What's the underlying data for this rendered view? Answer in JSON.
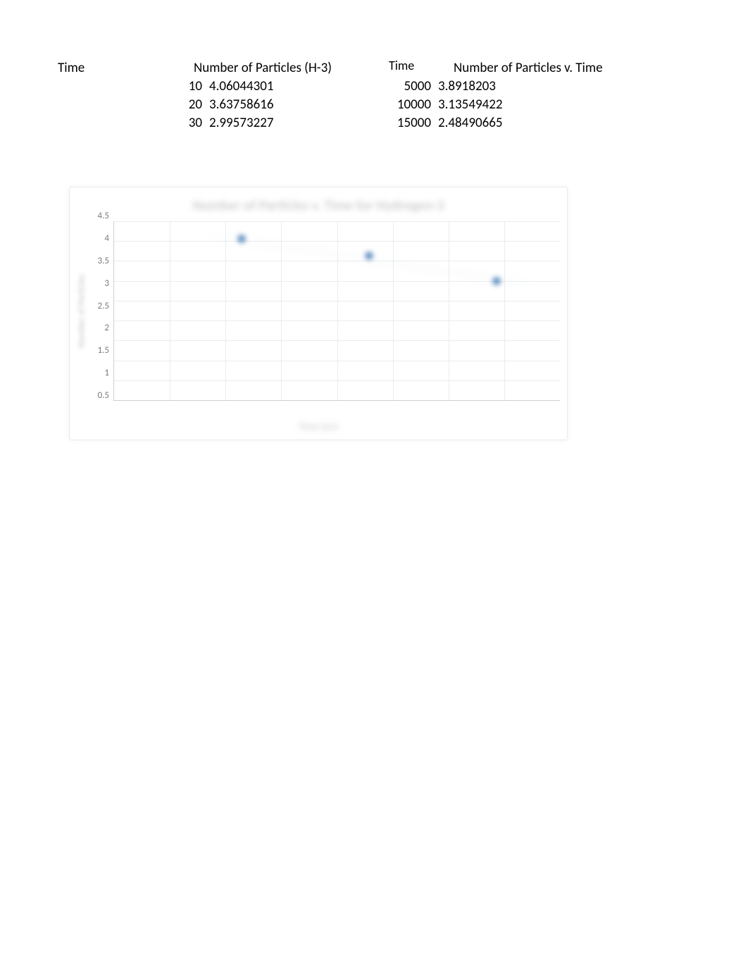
{
  "table1": {
    "header_time": "Time",
    "header_particles": "Number of Particles (H-3)",
    "rows": [
      {
        "time": "10",
        "value": "4.06044301"
      },
      {
        "time": "20",
        "value": "3.63758616"
      },
      {
        "time": "30",
        "value": "2.99573227"
      }
    ]
  },
  "table2": {
    "header_time": "Time",
    "header_particles": "Number of Particles v. Time",
    "rows": [
      {
        "time": "5000",
        "value": "3.8918203"
      },
      {
        "time": "10000",
        "value": "3.13549422"
      },
      {
        "time": "15000",
        "value": "2.48490665"
      }
    ]
  },
  "chart": {
    "title_label": "Number of Particles v. Time for Hydrogen-3",
    "xlabel": "Time (yrs)",
    "ylabel": "Number of Particles",
    "yticks": [
      "4.5",
      "4",
      "3.5",
      "3",
      "2.5",
      "2",
      "1.5",
      "1",
      "0.5"
    ]
  },
  "chart_data": {
    "type": "scatter",
    "title": "Number of Particles v. Time for Hydrogen-3",
    "xlabel": "Time (yrs)",
    "ylabel": "Number of Particles",
    "ylim": [
      0,
      4.5
    ],
    "xlim": [
      0,
      35
    ],
    "series": [
      {
        "name": "H-3",
        "x": [
          10,
          20,
          30
        ],
        "y": [
          4.06044301,
          3.63758616,
          2.99573227
        ]
      }
    ],
    "trendline": {
      "x": [
        8,
        32
      ],
      "y": [
        4.1,
        2.95
      ]
    }
  }
}
